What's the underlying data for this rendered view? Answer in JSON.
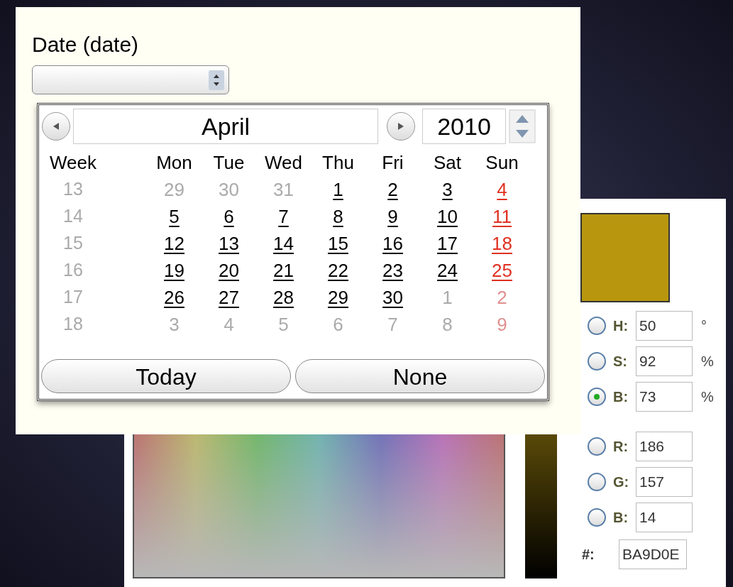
{
  "date_panel": {
    "label": "Date (date)",
    "calendar": {
      "month": "April",
      "year": "2010",
      "columns": [
        "Week",
        "Mon",
        "Tue",
        "Wed",
        "Thu",
        "Fri",
        "Sat",
        "Sun"
      ],
      "weeks": [
        {
          "number": "13",
          "days": [
            {
              "label": "29",
              "in_month": false,
              "holiday": false
            },
            {
              "label": "30",
              "in_month": false,
              "holiday": false
            },
            {
              "label": "31",
              "in_month": false,
              "holiday": false
            },
            {
              "label": "1",
              "in_month": true,
              "holiday": false
            },
            {
              "label": "2",
              "in_month": true,
              "holiday": false
            },
            {
              "label": "3",
              "in_month": true,
              "holiday": false
            },
            {
              "label": "4",
              "in_month": true,
              "holiday": true
            }
          ]
        },
        {
          "number": "14",
          "days": [
            {
              "label": "5",
              "in_month": true,
              "holiday": false
            },
            {
              "label": "6",
              "in_month": true,
              "holiday": false
            },
            {
              "label": "7",
              "in_month": true,
              "holiday": false
            },
            {
              "label": "8",
              "in_month": true,
              "holiday": false
            },
            {
              "label": "9",
              "in_month": true,
              "holiday": false
            },
            {
              "label": "10",
              "in_month": true,
              "holiday": false
            },
            {
              "label": "11",
              "in_month": true,
              "holiday": true
            }
          ]
        },
        {
          "number": "15",
          "days": [
            {
              "label": "12",
              "in_month": true,
              "holiday": false
            },
            {
              "label": "13",
              "in_month": true,
              "holiday": false
            },
            {
              "label": "14",
              "in_month": true,
              "holiday": false
            },
            {
              "label": "15",
              "in_month": true,
              "holiday": false
            },
            {
              "label": "16",
              "in_month": true,
              "holiday": false
            },
            {
              "label": "17",
              "in_month": true,
              "holiday": false
            },
            {
              "label": "18",
              "in_month": true,
              "holiday": true
            }
          ]
        },
        {
          "number": "16",
          "days": [
            {
              "label": "19",
              "in_month": true,
              "holiday": false
            },
            {
              "label": "20",
              "in_month": true,
              "holiday": false
            },
            {
              "label": "21",
              "in_month": true,
              "holiday": false
            },
            {
              "label": "22",
              "in_month": true,
              "holiday": false
            },
            {
              "label": "23",
              "in_month": true,
              "holiday": false
            },
            {
              "label": "24",
              "in_month": true,
              "holiday": false
            },
            {
              "label": "25",
              "in_month": true,
              "holiday": true
            }
          ]
        },
        {
          "number": "17",
          "days": [
            {
              "label": "26",
              "in_month": true,
              "holiday": false
            },
            {
              "label": "27",
              "in_month": true,
              "holiday": false
            },
            {
              "label": "28",
              "in_month": true,
              "holiday": false
            },
            {
              "label": "29",
              "in_month": true,
              "holiday": false
            },
            {
              "label": "30",
              "in_month": true,
              "holiday": false
            },
            {
              "label": "1",
              "in_month": false,
              "holiday": false
            },
            {
              "label": "2",
              "in_month": false,
              "holiday": true
            }
          ]
        },
        {
          "number": "18",
          "days": [
            {
              "label": "3",
              "in_month": false,
              "holiday": false
            },
            {
              "label": "4",
              "in_month": false,
              "holiday": false
            },
            {
              "label": "5",
              "in_month": false,
              "holiday": false
            },
            {
              "label": "6",
              "in_month": false,
              "holiday": false
            },
            {
              "label": "7",
              "in_month": false,
              "holiday": false
            },
            {
              "label": "8",
              "in_month": false,
              "holiday": false
            },
            {
              "label": "9",
              "in_month": false,
              "holiday": true
            }
          ]
        }
      ],
      "buttons": [
        "Today",
        "None"
      ]
    }
  },
  "color_panel": {
    "swatch": {
      "color": "#b8970f"
    },
    "fields": [
      {
        "label": "H:",
        "value": "50",
        "unit": "°",
        "selected": false
      },
      {
        "label": "S:",
        "value": "92",
        "unit": "%",
        "selected": false
      },
      {
        "label": "B:",
        "value": "73",
        "unit": "%",
        "selected": true
      },
      {
        "label": "R:",
        "value": "186",
        "selected": false
      },
      {
        "label": "G:",
        "value": "157",
        "selected": false
      },
      {
        "label": "B:",
        "value": "14",
        "selected": false
      }
    ],
    "hex": {
      "label": "#:",
      "value": "BA9D0E"
    }
  }
}
